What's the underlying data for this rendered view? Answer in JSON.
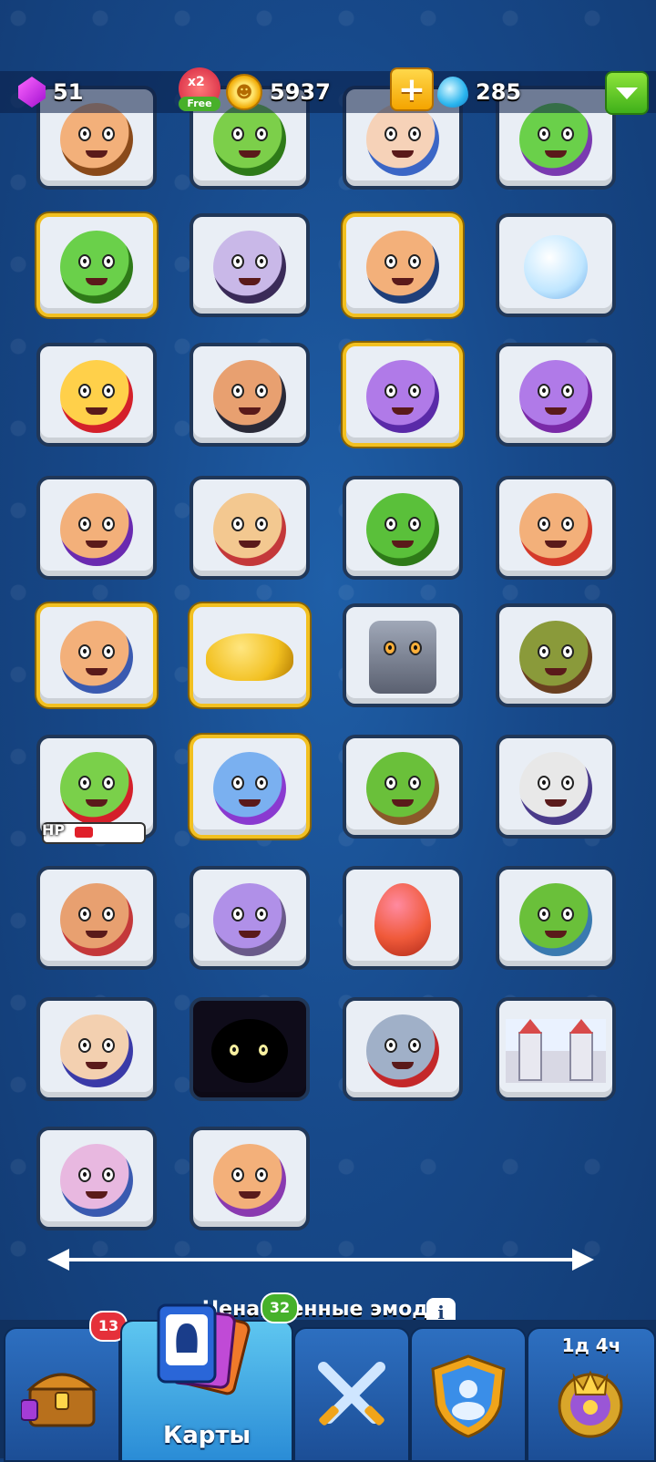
{
  "topbar": {
    "gems": "51",
    "boost_multiplier": "x2",
    "boost_label": "Free",
    "coins": "5937",
    "crystals": "285"
  },
  "icons": {
    "gem": "gem-icon",
    "coin": "coin-icon",
    "crystal": "crystal-drop-icon"
  },
  "emojis": [
    "dwarf-cake",
    "cactus-drink",
    "hooded-girl",
    "witch-cactus",
    "goblin-clouds",
    "vampire",
    "boy-cap",
    "ice-duck",
    "horn-flower",
    "monk",
    "vampire-girl-duck",
    "vampire-lady",
    "witch-wand",
    "jester",
    "cactus-sunglasses",
    "cheerleader",
    "icecream-kid",
    "genie-lamp",
    "golem",
    "treant",
    "dizzy-goblin",
    "bunny-girl",
    "cowboy-cactus",
    "plague-mage",
    "pirate",
    "meat-eater",
    "dragon-egg",
    "old-cactus",
    "old-wizard",
    "shadow-cat",
    "wolf",
    "castle",
    "elf-mage",
    "sorceress"
  ],
  "hp_label": "HP",
  "hp_fill_fraction": 0.18,
  "footer": {
    "undiscovered_label": "Ненайденные эмодзи",
    "info_label": "i"
  },
  "nav": {
    "chest_badge": "13",
    "cards_badge": "32",
    "cards_label": "Карты",
    "clan_timer": "1д 4ч"
  }
}
